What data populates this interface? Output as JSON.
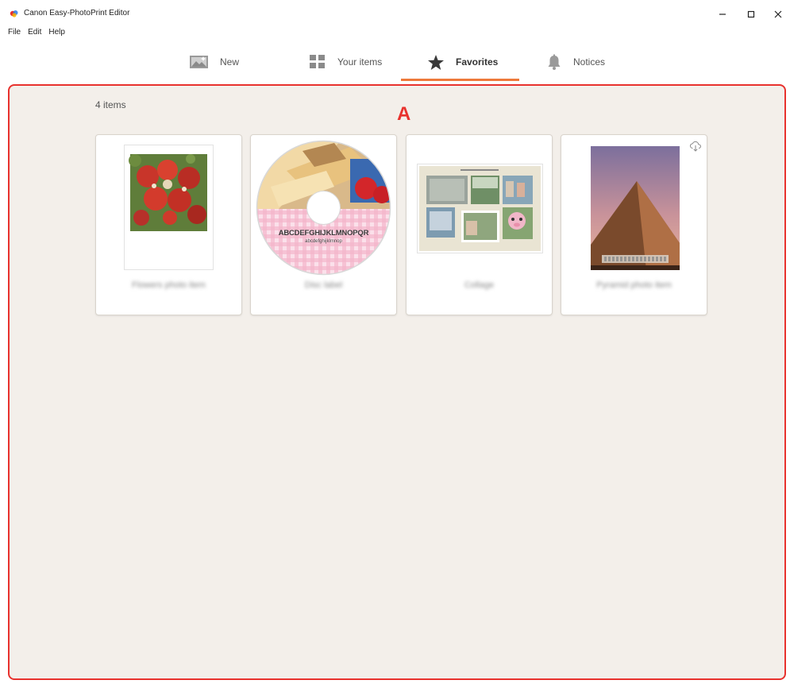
{
  "window": {
    "title": "Canon Easy-PhotoPrint Editor",
    "minimize_icon": "minimize-icon",
    "maximize_icon": "maximize-icon",
    "close_icon": "close-icon"
  },
  "menu": {
    "file": "File",
    "edit": "Edit",
    "help": "Help"
  },
  "tabs": [
    {
      "label": "New",
      "icon": "new-photo-icon"
    },
    {
      "label": "Your items",
      "icon": "grid-icon"
    },
    {
      "label": "Favorites",
      "icon": "star-icon",
      "active": true
    },
    {
      "label": "Notices",
      "icon": "bell-icon"
    }
  ],
  "main": {
    "count": "4 items",
    "marker": "A"
  },
  "items": [
    {
      "name": "Flowers photo item",
      "thumbnail": "flower-bouquet"
    },
    {
      "name": "Disc label",
      "thumbnail": "disc-label",
      "disc_text": "ABCDEFGHIJKLMNOPQR",
      "disc_subtext": "abcdefghijklmnop"
    },
    {
      "name": "Collage",
      "thumbnail": "photo-collage"
    },
    {
      "name": "Pyramid photo item",
      "thumbnail": "pyramid-photo",
      "download_icon": "cloud-download-icon"
    }
  ],
  "colors": {
    "accent": "#ee7a3b",
    "highlight_border": "#e8322e",
    "panel_background": "#f3efea"
  }
}
